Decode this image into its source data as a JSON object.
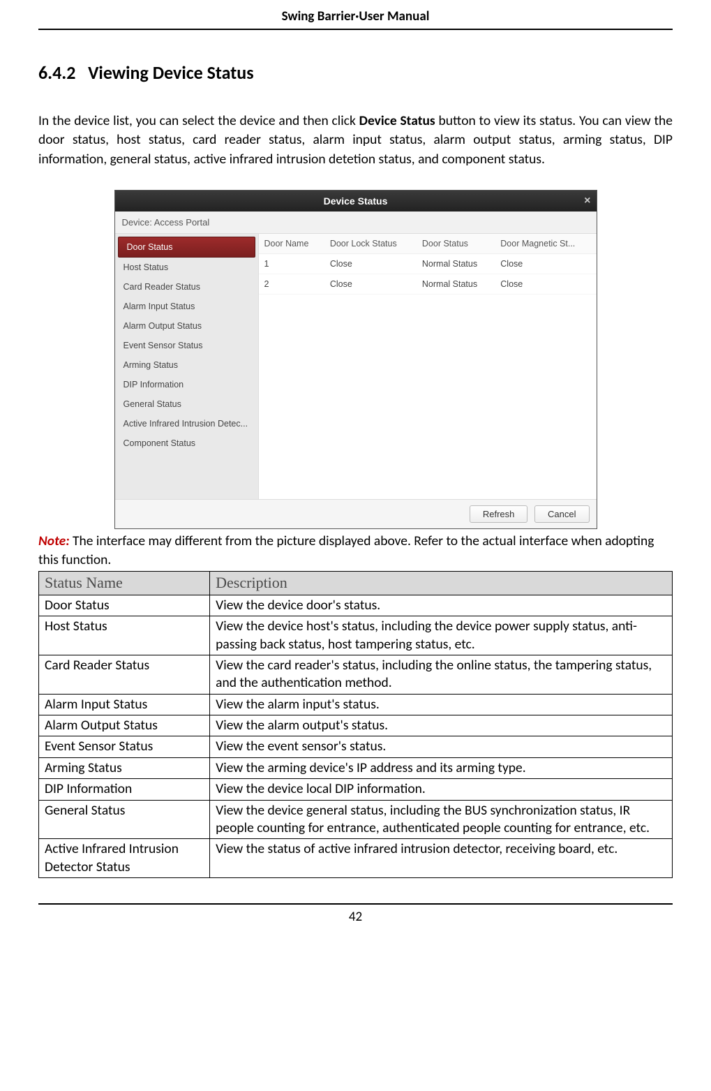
{
  "header": {
    "title": "Swing Barrier·User Manual"
  },
  "section": {
    "number": "6.4.2",
    "title": "Viewing Device Status"
  },
  "intro": {
    "p1a": "In the device list, you can select the device and then click ",
    "p1b": "Device Status",
    "p1c": " button to view its status. You can view the door status, host status, card reader status, alarm input status, alarm output status, arming status, DIP information, general status, active infrared intrusion detetion status, and component status."
  },
  "dialog": {
    "title": "Device Status",
    "device_label": "Device:",
    "device_name": "Access Portal",
    "sidebar_items": [
      "Door Status",
      "Host Status",
      "Card Reader Status",
      "Alarm Input Status",
      "Alarm Output Status",
      "Event Sensor Status",
      "Arming Status",
      "DIP Information",
      "General Status",
      "Active Infrared Intrusion Detec...",
      "Component Status"
    ],
    "table_headers": [
      "Door Name",
      "Door Lock Status",
      "Door Status",
      "Door Magnetic St..."
    ],
    "table_rows": [
      [
        "1",
        "Close",
        "Normal Status",
        "Close"
      ],
      [
        "2",
        "Close",
        "Normal Status",
        "Close"
      ]
    ],
    "buttons": {
      "refresh": "Refresh",
      "cancel": "Cancel"
    }
  },
  "note": {
    "label": "Note:",
    "text": " The interface may different from the picture displayed above. Refer to the actual interface when adopting this function."
  },
  "desc_table": {
    "head": {
      "c1": "Status Name",
      "c2": "Description"
    },
    "rows": [
      {
        "name": "Door Status",
        "desc": "View the device door's status."
      },
      {
        "name": "Host Status",
        "desc": "View the device host's status, including the device power supply status, anti-passing back status, host tampering status, etc."
      },
      {
        "name": "Card Reader Status",
        "desc": "View the card reader's status, including the online status, the tampering status, and the authentication method."
      },
      {
        "name": "Alarm Input Status",
        "desc": "View the alarm input's status."
      },
      {
        "name": "Alarm Output Status",
        "desc": "View the alarm output's status."
      },
      {
        "name": "Event Sensor Status",
        "desc": "View the event sensor's status."
      },
      {
        "name": "Arming Status",
        "desc": "View the arming device's IP address and its arming type."
      },
      {
        "name": "DIP Information",
        "desc": "View the device local DIP information."
      },
      {
        "name": "General Status",
        "desc": "View the device general status, including the BUS synchronization status, IR people counting for entrance, authenticated people counting for entrance, etc."
      },
      {
        "name": "Active Infrared Intrusion Detector Status",
        "desc": "View the status of active infrared intrusion detector, receiving board, etc."
      }
    ]
  },
  "footer": {
    "page": "42"
  }
}
